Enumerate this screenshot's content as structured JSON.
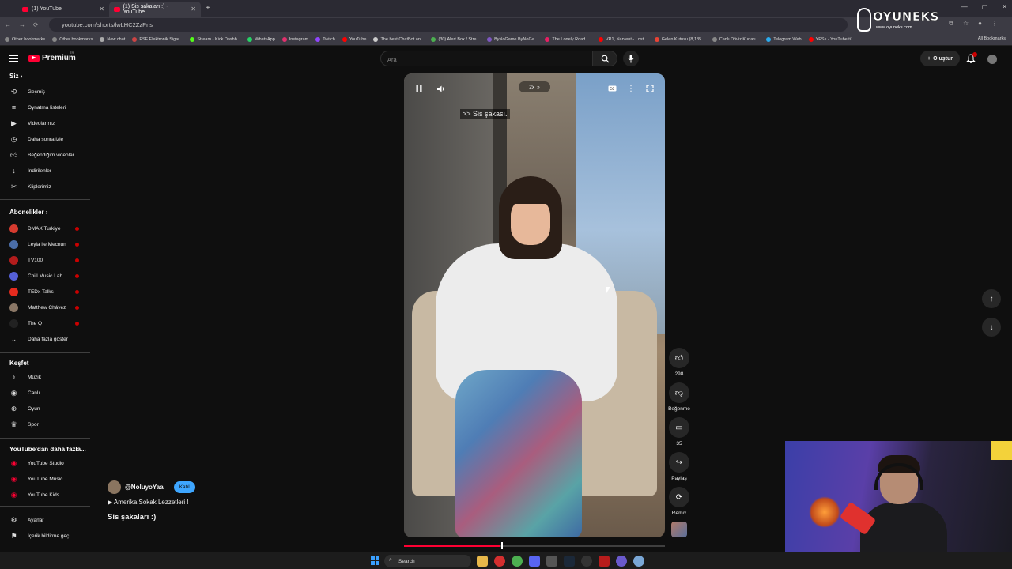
{
  "browser": {
    "tabs": [
      {
        "title": "(1) YouTube"
      },
      {
        "title": "(1) Sis şakaları :) - YouTube"
      }
    ],
    "url": "youtube.com/shorts/lwLHC2ZzPns",
    "bookmarks": [
      "Other bookmarks",
      "Other bookmarks",
      "New chat",
      "ESF Elektronik Sigar...",
      "Stream - Kick Dashb...",
      "WhatsApp",
      "Instagram",
      "Twitch",
      "YouTube",
      "The best ChatBot an...",
      "(30) Alert Box / Stre...",
      "ByNoGame ByNoGa...",
      "The Lonely Road |...",
      "VR1, Narvent - Lost...",
      "Gelen Kutusu (8,185...",
      "Canlı Döviz Kurları...",
      "Telegram Web",
      "YESs - YouTube tü..."
    ],
    "all_bookmarks": "All Bookmarks"
  },
  "watermark": {
    "title": "OYUNEKS",
    "site": "www.oyuneks.com"
  },
  "header": {
    "logo_text": "Premium",
    "region": "TR",
    "search_placeholder": "Ara",
    "create_label": "Oluştur",
    "notification_count": "1"
  },
  "sidebar": {
    "you_title": "Siz",
    "you_items": [
      {
        "label": "Geçmiş",
        "icon": "history-icon"
      },
      {
        "label": "Oynatma listeleri",
        "icon": "playlist-icon"
      },
      {
        "label": "Videolarınız",
        "icon": "video-icon"
      },
      {
        "label": "Daha sonra izle",
        "icon": "clock-icon"
      },
      {
        "label": "Beğendiğim videolar",
        "icon": "thumbs-up-icon"
      },
      {
        "label": "İndirilenler",
        "icon": "download-icon"
      },
      {
        "label": "Kliplerimiz",
        "icon": "scissors-icon"
      }
    ],
    "subs_title": "Abonelikler",
    "subs": [
      {
        "label": "DMAX Turkiye",
        "color": "#d63b2f"
      },
      {
        "label": "Leyla ile Mecnun",
        "color": "#4b6ea8"
      },
      {
        "label": "TV100",
        "color": "#b31c1c"
      },
      {
        "label": "Chill Music Lab",
        "color": "#5560d8"
      },
      {
        "label": "TEDx Talks",
        "color": "#e62b1e"
      },
      {
        "label": "Matthew Chávez",
        "color": "#8a7766"
      },
      {
        "label": "The Q",
        "color": "#222222"
      }
    ],
    "show_more": "Daha fazla göster",
    "explore_title": "Keşfet",
    "explore": [
      {
        "label": "Müzik",
        "icon": "music-icon"
      },
      {
        "label": "Canlı",
        "icon": "live-icon"
      },
      {
        "label": "Oyun",
        "icon": "gamepad-icon"
      },
      {
        "label": "Spor",
        "icon": "trophy-icon"
      }
    ],
    "more_title": "YouTube'dan daha fazla...",
    "more": [
      {
        "label": "YouTube Studio"
      },
      {
        "label": "YouTube Music"
      },
      {
        "label": "YouTube Kids"
      }
    ],
    "settings": "Ayarlar",
    "report": "İçerik bildirme geç..."
  },
  "player": {
    "speed": "2x",
    "caption": ">> Sis şakası.",
    "progress": 0.37
  },
  "actions": {
    "likes": "298",
    "dislike_label": "Beğenme",
    "comments": "35",
    "share_label": "Paylaş",
    "remix_label": "Remix"
  },
  "channel": {
    "handle": "@NoluyoYaa",
    "join_label": "Katıl",
    "playlist": "▶ Amerika Sokak Lezzetleri !",
    "video_title": "Sis şakaları :)"
  },
  "taskbar": {
    "search_label": "Search"
  }
}
